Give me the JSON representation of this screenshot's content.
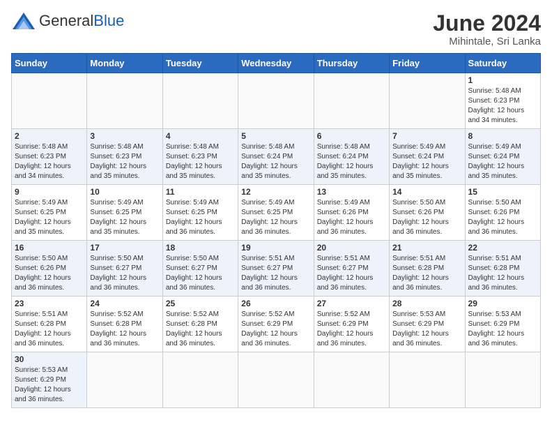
{
  "header": {
    "logo_general": "General",
    "logo_blue": "Blue",
    "month_title": "June 2024",
    "location": "Mihintale, Sri Lanka"
  },
  "weekdays": [
    "Sunday",
    "Monday",
    "Tuesday",
    "Wednesday",
    "Thursday",
    "Friday",
    "Saturday"
  ],
  "weeks": [
    [
      {
        "day": null
      },
      {
        "day": null
      },
      {
        "day": null
      },
      {
        "day": null
      },
      {
        "day": null
      },
      {
        "day": null
      },
      {
        "day": 1,
        "sunrise": "5:48 AM",
        "sunset": "6:23 PM",
        "daylight": "12 hours and 34 minutes."
      }
    ],
    [
      {
        "day": 2,
        "sunrise": "5:48 AM",
        "sunset": "6:23 PM",
        "daylight": "12 hours and 34 minutes."
      },
      {
        "day": 3,
        "sunrise": "5:48 AM",
        "sunset": "6:23 PM",
        "daylight": "12 hours and 35 minutes."
      },
      {
        "day": 4,
        "sunrise": "5:48 AM",
        "sunset": "6:23 PM",
        "daylight": "12 hours and 35 minutes."
      },
      {
        "day": 5,
        "sunrise": "5:48 AM",
        "sunset": "6:24 PM",
        "daylight": "12 hours and 35 minutes."
      },
      {
        "day": 6,
        "sunrise": "5:48 AM",
        "sunset": "6:24 PM",
        "daylight": "12 hours and 35 minutes."
      },
      {
        "day": 7,
        "sunrise": "5:49 AM",
        "sunset": "6:24 PM",
        "daylight": "12 hours and 35 minutes."
      },
      {
        "day": 8,
        "sunrise": "5:49 AM",
        "sunset": "6:24 PM",
        "daylight": "12 hours and 35 minutes."
      }
    ],
    [
      {
        "day": 9,
        "sunrise": "5:49 AM",
        "sunset": "6:25 PM",
        "daylight": "12 hours and 35 minutes."
      },
      {
        "day": 10,
        "sunrise": "5:49 AM",
        "sunset": "6:25 PM",
        "daylight": "12 hours and 35 minutes."
      },
      {
        "day": 11,
        "sunrise": "5:49 AM",
        "sunset": "6:25 PM",
        "daylight": "12 hours and 36 minutes."
      },
      {
        "day": 12,
        "sunrise": "5:49 AM",
        "sunset": "6:25 PM",
        "daylight": "12 hours and 36 minutes."
      },
      {
        "day": 13,
        "sunrise": "5:49 AM",
        "sunset": "6:26 PM",
        "daylight": "12 hours and 36 minutes."
      },
      {
        "day": 14,
        "sunrise": "5:50 AM",
        "sunset": "6:26 PM",
        "daylight": "12 hours and 36 minutes."
      },
      {
        "day": 15,
        "sunrise": "5:50 AM",
        "sunset": "6:26 PM",
        "daylight": "12 hours and 36 minutes."
      }
    ],
    [
      {
        "day": 16,
        "sunrise": "5:50 AM",
        "sunset": "6:26 PM",
        "daylight": "12 hours and 36 minutes."
      },
      {
        "day": 17,
        "sunrise": "5:50 AM",
        "sunset": "6:27 PM",
        "daylight": "12 hours and 36 minutes."
      },
      {
        "day": 18,
        "sunrise": "5:50 AM",
        "sunset": "6:27 PM",
        "daylight": "12 hours and 36 minutes."
      },
      {
        "day": 19,
        "sunrise": "5:51 AM",
        "sunset": "6:27 PM",
        "daylight": "12 hours and 36 minutes."
      },
      {
        "day": 20,
        "sunrise": "5:51 AM",
        "sunset": "6:27 PM",
        "daylight": "12 hours and 36 minutes."
      },
      {
        "day": 21,
        "sunrise": "5:51 AM",
        "sunset": "6:28 PM",
        "daylight": "12 hours and 36 minutes."
      },
      {
        "day": 22,
        "sunrise": "5:51 AM",
        "sunset": "6:28 PM",
        "daylight": "12 hours and 36 minutes."
      }
    ],
    [
      {
        "day": 23,
        "sunrise": "5:51 AM",
        "sunset": "6:28 PM",
        "daylight": "12 hours and 36 minutes."
      },
      {
        "day": 24,
        "sunrise": "5:52 AM",
        "sunset": "6:28 PM",
        "daylight": "12 hours and 36 minutes."
      },
      {
        "day": 25,
        "sunrise": "5:52 AM",
        "sunset": "6:28 PM",
        "daylight": "12 hours and 36 minutes."
      },
      {
        "day": 26,
        "sunrise": "5:52 AM",
        "sunset": "6:29 PM",
        "daylight": "12 hours and 36 minutes."
      },
      {
        "day": 27,
        "sunrise": "5:52 AM",
        "sunset": "6:29 PM",
        "daylight": "12 hours and 36 minutes."
      },
      {
        "day": 28,
        "sunrise": "5:53 AM",
        "sunset": "6:29 PM",
        "daylight": "12 hours and 36 minutes."
      },
      {
        "day": 29,
        "sunrise": "5:53 AM",
        "sunset": "6:29 PM",
        "daylight": "12 hours and 36 minutes."
      }
    ],
    [
      {
        "day": 30,
        "sunrise": "5:53 AM",
        "sunset": "6:29 PM",
        "daylight": "12 hours and 36 minutes."
      },
      {
        "day": null
      },
      {
        "day": null
      },
      {
        "day": null
      },
      {
        "day": null
      },
      {
        "day": null
      },
      {
        "day": null
      }
    ]
  ],
  "labels": {
    "sunrise": "Sunrise:",
    "sunset": "Sunset:",
    "daylight": "Daylight:"
  }
}
